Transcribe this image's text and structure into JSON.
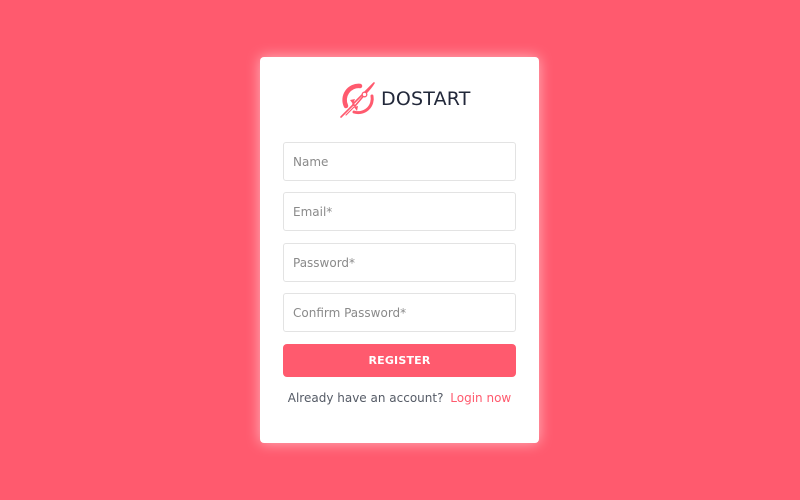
{
  "brand": {
    "name": "DOSTART",
    "icon": "rocket-icon",
    "accent_color": "#ff5a6e"
  },
  "form": {
    "name_placeholder": "Name",
    "email_placeholder": "Email*",
    "password_placeholder": "Password*",
    "confirm_password_placeholder": "Confirm Password*",
    "submit_label": "REGISTER"
  },
  "footer": {
    "prompt": "Already have an account?",
    "link_label": "Login now"
  },
  "colors": {
    "background": "#ff5a6e",
    "card": "#ffffff",
    "text_dark": "#22283a"
  }
}
